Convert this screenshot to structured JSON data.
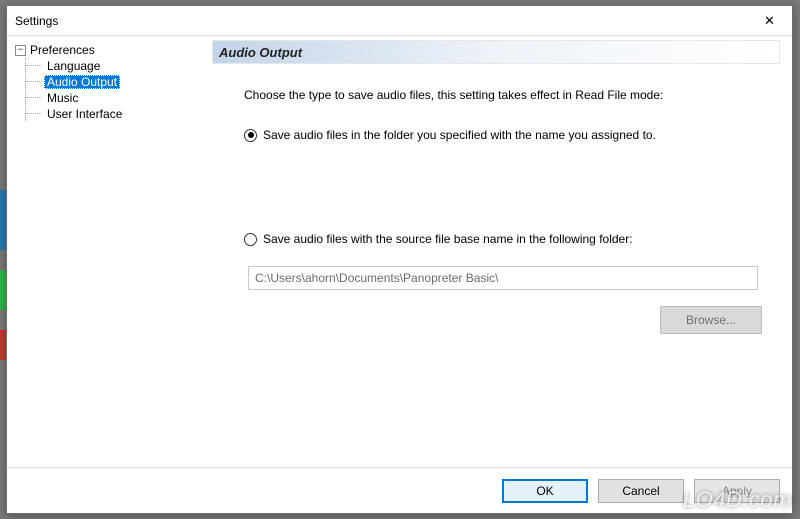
{
  "window": {
    "title": "Settings",
    "close_glyph": "✕"
  },
  "tree": {
    "root": "Preferences",
    "expander_glyph": "−",
    "items": [
      {
        "label": "Language",
        "selected": false
      },
      {
        "label": "Audio Output",
        "selected": true
      },
      {
        "label": "Music",
        "selected": false
      },
      {
        "label": "User Interface",
        "selected": false
      }
    ]
  },
  "panel": {
    "heading": "Audio Output",
    "intro": "Choose the type to save audio files, this setting takes effect in Read File mode:",
    "option1": "Save audio files in the folder you specified with the name you assigned to.",
    "option2": "Save audio files with the source file base name in the following folder:",
    "selected_option": 1,
    "path_value": "C:\\Users\\ahorn\\Documents\\Panopreter Basic\\",
    "browse_label": "Browse...",
    "browse_enabled": false
  },
  "footer": {
    "ok": "OK",
    "cancel": "Cancel",
    "apply": "Apply",
    "apply_enabled": false
  },
  "watermark": "LO4D.com"
}
